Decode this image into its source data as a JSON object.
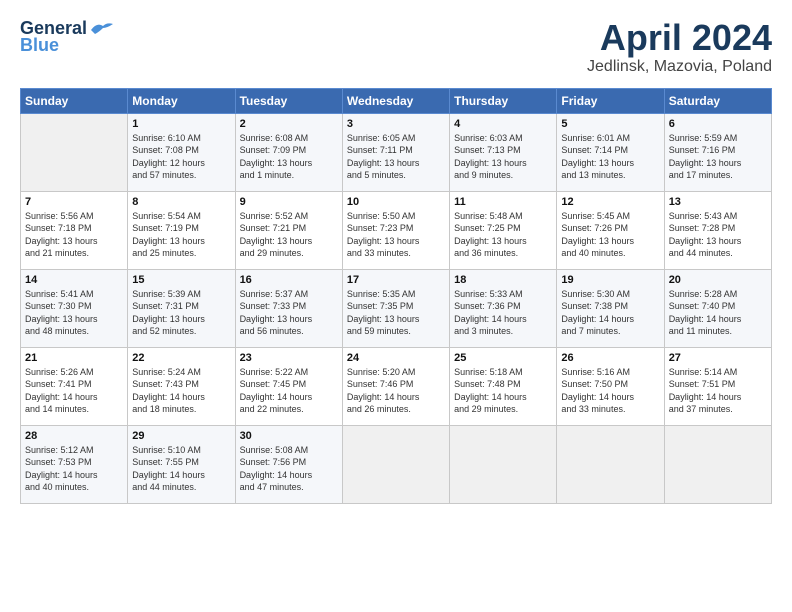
{
  "logo": {
    "line1": "General",
    "line2": "Blue",
    "bird_unicode": "🐦"
  },
  "title": "April 2024",
  "subtitle": "Jedlinsk, Mazovia, Poland",
  "days_header": [
    "Sunday",
    "Monday",
    "Tuesday",
    "Wednesday",
    "Thursday",
    "Friday",
    "Saturday"
  ],
  "weeks": [
    [
      {
        "day": "",
        "info": ""
      },
      {
        "day": "1",
        "info": "Sunrise: 6:10 AM\nSunset: 7:08 PM\nDaylight: 12 hours\nand 57 minutes."
      },
      {
        "day": "2",
        "info": "Sunrise: 6:08 AM\nSunset: 7:09 PM\nDaylight: 13 hours\nand 1 minute."
      },
      {
        "day": "3",
        "info": "Sunrise: 6:05 AM\nSunset: 7:11 PM\nDaylight: 13 hours\nand 5 minutes."
      },
      {
        "day": "4",
        "info": "Sunrise: 6:03 AM\nSunset: 7:13 PM\nDaylight: 13 hours\nand 9 minutes."
      },
      {
        "day": "5",
        "info": "Sunrise: 6:01 AM\nSunset: 7:14 PM\nDaylight: 13 hours\nand 13 minutes."
      },
      {
        "day": "6",
        "info": "Sunrise: 5:59 AM\nSunset: 7:16 PM\nDaylight: 13 hours\nand 17 minutes."
      }
    ],
    [
      {
        "day": "7",
        "info": "Sunrise: 5:56 AM\nSunset: 7:18 PM\nDaylight: 13 hours\nand 21 minutes."
      },
      {
        "day": "8",
        "info": "Sunrise: 5:54 AM\nSunset: 7:19 PM\nDaylight: 13 hours\nand 25 minutes."
      },
      {
        "day": "9",
        "info": "Sunrise: 5:52 AM\nSunset: 7:21 PM\nDaylight: 13 hours\nand 29 minutes."
      },
      {
        "day": "10",
        "info": "Sunrise: 5:50 AM\nSunset: 7:23 PM\nDaylight: 13 hours\nand 33 minutes."
      },
      {
        "day": "11",
        "info": "Sunrise: 5:48 AM\nSunset: 7:25 PM\nDaylight: 13 hours\nand 36 minutes."
      },
      {
        "day": "12",
        "info": "Sunrise: 5:45 AM\nSunset: 7:26 PM\nDaylight: 13 hours\nand 40 minutes."
      },
      {
        "day": "13",
        "info": "Sunrise: 5:43 AM\nSunset: 7:28 PM\nDaylight: 13 hours\nand 44 minutes."
      }
    ],
    [
      {
        "day": "14",
        "info": "Sunrise: 5:41 AM\nSunset: 7:30 PM\nDaylight: 13 hours\nand 48 minutes."
      },
      {
        "day": "15",
        "info": "Sunrise: 5:39 AM\nSunset: 7:31 PM\nDaylight: 13 hours\nand 52 minutes."
      },
      {
        "day": "16",
        "info": "Sunrise: 5:37 AM\nSunset: 7:33 PM\nDaylight: 13 hours\nand 56 minutes."
      },
      {
        "day": "17",
        "info": "Sunrise: 5:35 AM\nSunset: 7:35 PM\nDaylight: 13 hours\nand 59 minutes."
      },
      {
        "day": "18",
        "info": "Sunrise: 5:33 AM\nSunset: 7:36 PM\nDaylight: 14 hours\nand 3 minutes."
      },
      {
        "day": "19",
        "info": "Sunrise: 5:30 AM\nSunset: 7:38 PM\nDaylight: 14 hours\nand 7 minutes."
      },
      {
        "day": "20",
        "info": "Sunrise: 5:28 AM\nSunset: 7:40 PM\nDaylight: 14 hours\nand 11 minutes."
      }
    ],
    [
      {
        "day": "21",
        "info": "Sunrise: 5:26 AM\nSunset: 7:41 PM\nDaylight: 14 hours\nand 14 minutes."
      },
      {
        "day": "22",
        "info": "Sunrise: 5:24 AM\nSunset: 7:43 PM\nDaylight: 14 hours\nand 18 minutes."
      },
      {
        "day": "23",
        "info": "Sunrise: 5:22 AM\nSunset: 7:45 PM\nDaylight: 14 hours\nand 22 minutes."
      },
      {
        "day": "24",
        "info": "Sunrise: 5:20 AM\nSunset: 7:46 PM\nDaylight: 14 hours\nand 26 minutes."
      },
      {
        "day": "25",
        "info": "Sunrise: 5:18 AM\nSunset: 7:48 PM\nDaylight: 14 hours\nand 29 minutes."
      },
      {
        "day": "26",
        "info": "Sunrise: 5:16 AM\nSunset: 7:50 PM\nDaylight: 14 hours\nand 33 minutes."
      },
      {
        "day": "27",
        "info": "Sunrise: 5:14 AM\nSunset: 7:51 PM\nDaylight: 14 hours\nand 37 minutes."
      }
    ],
    [
      {
        "day": "28",
        "info": "Sunrise: 5:12 AM\nSunset: 7:53 PM\nDaylight: 14 hours\nand 40 minutes."
      },
      {
        "day": "29",
        "info": "Sunrise: 5:10 AM\nSunset: 7:55 PM\nDaylight: 14 hours\nand 44 minutes."
      },
      {
        "day": "30",
        "info": "Sunrise: 5:08 AM\nSunset: 7:56 PM\nDaylight: 14 hours\nand 47 minutes."
      },
      {
        "day": "",
        "info": ""
      },
      {
        "day": "",
        "info": ""
      },
      {
        "day": "",
        "info": ""
      },
      {
        "day": "",
        "info": ""
      }
    ]
  ]
}
